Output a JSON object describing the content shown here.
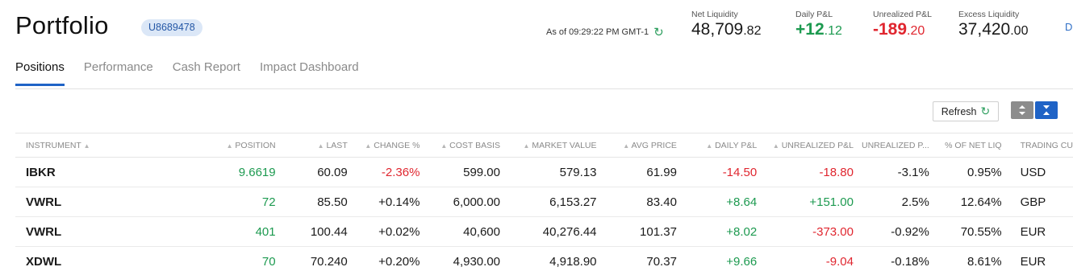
{
  "header": {
    "title": "Portfolio",
    "account_id": "U8689478",
    "as_of": "As of 09:29:22 PM GMT-1",
    "edge_letter": "D",
    "metrics": [
      {
        "label": "Net Liquidity",
        "int": "48,709",
        "dec": ".82"
      },
      {
        "label": "Daily P&L",
        "int": "+12",
        "dec": ".12"
      },
      {
        "label": "Unrealized P&L",
        "int": "-189",
        "dec": ".20"
      },
      {
        "label": "Excess Liquidity",
        "int": "37,420",
        "dec": ".00"
      }
    ]
  },
  "tabs": [
    "Positions",
    "Performance",
    "Cash Report",
    "Impact Dashboard"
  ],
  "toolbar": {
    "refresh_label": "Refresh"
  },
  "table": {
    "columns": [
      "INSTRUMENT",
      "POSITION",
      "LAST",
      "CHANGE %",
      "COST BASIS",
      "MARKET VALUE",
      "AVG PRICE",
      "DAILY P&L",
      "UNREALIZED P&L",
      "UNREALIZED P...",
      "% OF NET LIQ",
      "TRADING CU"
    ],
    "rows": [
      [
        "IBKR",
        "9.6619",
        "60.09",
        "-2.36%",
        "599.00",
        "579.13",
        "61.99",
        "-14.50",
        "-18.80",
        "-3.1%",
        "0.95%",
        "USD"
      ],
      [
        "VWRL",
        "72",
        "85.50",
        "+0.14%",
        "6,000.00",
        "6,153.27",
        "83.40",
        "+8.64",
        "+151.00",
        "2.5%",
        "12.64%",
        "GBP"
      ],
      [
        "VWRL",
        "401",
        "100.44",
        "+0.02%",
        "40,600",
        "40,276.44",
        "101.37",
        "+8.02",
        "-373.00",
        "-0.92%",
        "70.55%",
        "EUR"
      ],
      [
        "XDWL",
        "70",
        "70.240",
        "+0.20%",
        "4,930.00",
        "4,918.90",
        "70.37",
        "+9.66",
        "-9.04",
        "-0.18%",
        "8.61%",
        "EUR"
      ]
    ]
  },
  "colors": {
    "accent": "#1f63c6",
    "positive": "#1d9a50",
    "negative": "#e0262f"
  }
}
